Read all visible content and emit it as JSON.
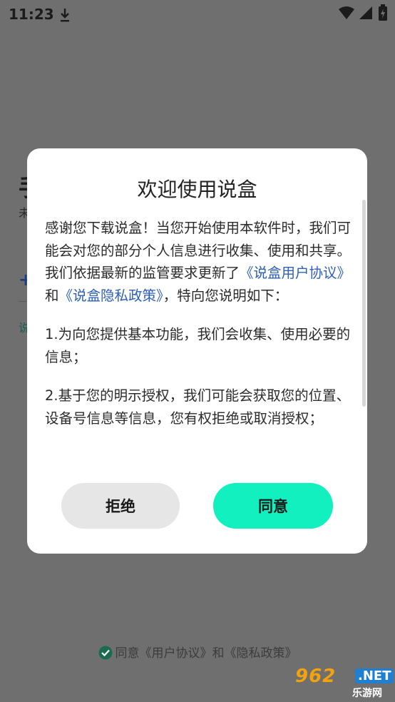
{
  "status_bar": {
    "time": "11:23"
  },
  "background": {
    "big_char": "手",
    "small_char": "未",
    "plus": "+",
    "small_char2": "说",
    "bottom_agree": {
      "text_pre": "同意",
      "link1": "《用户协议》",
      "text_mid": "和",
      "link2": "《隐私政策》"
    }
  },
  "dialog": {
    "title": "欢迎使用说盒",
    "para1_a": "感谢您下载说盒！当您开始使用本软件时，我们可能会对您的部分个人信息进行收集、使用和共享。我们依据最新的监管要求更新了",
    "para1_link1": "《说盒用户协议》",
    "para1_b": "和",
    "para1_link2": "《说盒隐私政策》",
    "para1_c": "，特向您说明如下：",
    "para2": "1.为向您提供基本功能，我们会收集、使用必要的信息；",
    "para3": "2.基于您的明示授权，我们可能会获取您的位置、设备号信息等信息，您有权拒绝或取消授权；",
    "reject_label": "拒绝",
    "agree_label": "同意"
  },
  "watermark": {
    "number": "962",
    "net": ".NET",
    "sub": "乐游网"
  },
  "colors": {
    "accent": "#12f0bf",
    "link": "#2d5fb8",
    "overlay": "#6f6f6f"
  }
}
